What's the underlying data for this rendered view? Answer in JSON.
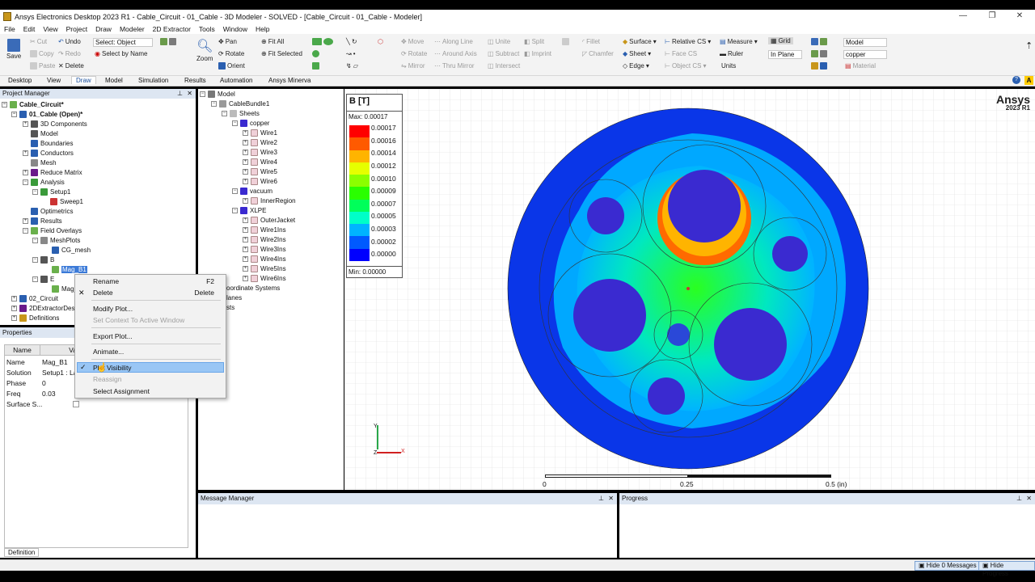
{
  "window": {
    "title": "Ansys Electronics Desktop 2023 R1 - Cable_Circuit - 01_Cable - 3D Modeler - SOLVED - [Cable_Circuit - 01_Cable - Modeler]"
  },
  "menu": [
    "File",
    "Edit",
    "View",
    "Project",
    "Draw",
    "Modeler",
    "2D Extractor",
    "Tools",
    "Window",
    "Help"
  ],
  "ribbon": {
    "save": "Save",
    "cut": "Cut",
    "copy": "Copy",
    "paste": "Paste",
    "undo": "Undo",
    "redo": "Redo",
    "delete": "Delete",
    "select_label": "Select: Object",
    "select_by_name": "Select by Name",
    "zoom": "Zoom",
    "pan": "Pan",
    "rotate": "Rotate",
    "orient": "Orient",
    "fit_all": "Fit All",
    "fit_selected": "Fit Selected",
    "move": "Move",
    "rotate2": "Rotate",
    "mirror": "Mirror",
    "along_line": "Along Line",
    "around_axis": "Around Axis",
    "thru_mirror": "Thru Mirror",
    "unite": "Unite",
    "subtract": "Subtract",
    "intersect": "Intersect",
    "split": "Split",
    "imprint": "Imprint",
    "fillet": "Fillet",
    "chamfer": "Chamfer",
    "surface": "Surface",
    "sheet": "Sheet",
    "edge": "Edge",
    "relative_cs": "Relative CS",
    "face_cs": "Face CS",
    "object_cs": "Object CS",
    "measure": "Measure",
    "ruler": "Ruler",
    "units": "Units",
    "grid": "Grid",
    "in_plane": "In Plane",
    "model_select": "Model",
    "material_select": "copper",
    "material": "Material"
  },
  "tabs": [
    "Desktop",
    "View",
    "Draw",
    "Model",
    "Simulation",
    "Results",
    "Automation",
    "Ansys Minerva"
  ],
  "project_manager": {
    "title": "Project Manager",
    "items": [
      "Cable_Circuit*",
      "01_Cable (Open)*",
      "3D Components",
      "Model",
      "Boundaries",
      "Conductors",
      "Mesh",
      "Reduce Matrix",
      "Analysis",
      "Setup1",
      "Sweep1",
      "Optimetrics",
      "Results",
      "Field Overlays",
      "MeshPlots",
      "CG_mesh",
      "B",
      "Mag_B1",
      "E",
      "Mag_",
      "02_Circuit",
      "2DExtractorDesi",
      "Definitions"
    ]
  },
  "properties": {
    "title": "Properties",
    "col_name": "Name",
    "col_value": "Va",
    "rows": [
      [
        "Name",
        "Mag_B1"
      ],
      [
        "Solution",
        "Setup1 : Last"
      ],
      [
        "Phase",
        "0"
      ],
      [
        "Freq",
        "0.03"
      ],
      [
        "Surface S...",
        ""
      ]
    ],
    "footer_tab": "Definition"
  },
  "model_tree": {
    "items": [
      "Model",
      "CableBundle1",
      "Sheets",
      "copper",
      "Wire1",
      "Wire2",
      "Wire3",
      "Wire4",
      "Wire5",
      "Wire6",
      "vacuum",
      "InnerRegion",
      "XLPE",
      "OuterJacket",
      "Wire1Ins",
      "Wire2Ins",
      "Wire3Ins",
      "Wire4Ins",
      "Wire5Ins",
      "Wire6Ins",
      "oordinate Systems",
      "lanes",
      "sts"
    ]
  },
  "context_menu": {
    "rename": "Rename",
    "rename_sc": "F2",
    "delete": "Delete",
    "delete_sc": "Delete",
    "modify_plot": "Modify Plot...",
    "set_context": "Set Context To Active Window",
    "export_plot": "Export Plot...",
    "animate": "Animate...",
    "plot_visibility": "Plot Visibility",
    "reassign": "Reassign",
    "select_assignment": "Select Assignment"
  },
  "legend": {
    "title": "B [T]",
    "max": "Max: 0.00017",
    "min": "Min: 0.00000",
    "levels": [
      "0.00017",
      "0.00016",
      "0.00014",
      "0.00012",
      "0.00010",
      "0.00009",
      "0.00007",
      "0.00005",
      "0.00003",
      "0.00002",
      "0.00000"
    ],
    "colors": [
      "#ff0000",
      "#ff5a00",
      "#ffb400",
      "#e6ff00",
      "#8cff00",
      "#2aff00",
      "#00ff5a",
      "#00ffc8",
      "#00b4ff",
      "#005aff",
      "#0000ff"
    ]
  },
  "brand": {
    "name": "Ansys",
    "version": "2023 R1"
  },
  "scale": {
    "t0": "0",
    "t1": "0.25",
    "t2": "0.5 (in)"
  },
  "axes": {
    "y": "Y",
    "z": "Z",
    "x": "X"
  },
  "panels": {
    "message_manager": "Message Manager",
    "progress": "Progress"
  },
  "status": {
    "hide_messages": "Hide 0 Messages",
    "hide_progress": "Hide Progress"
  }
}
